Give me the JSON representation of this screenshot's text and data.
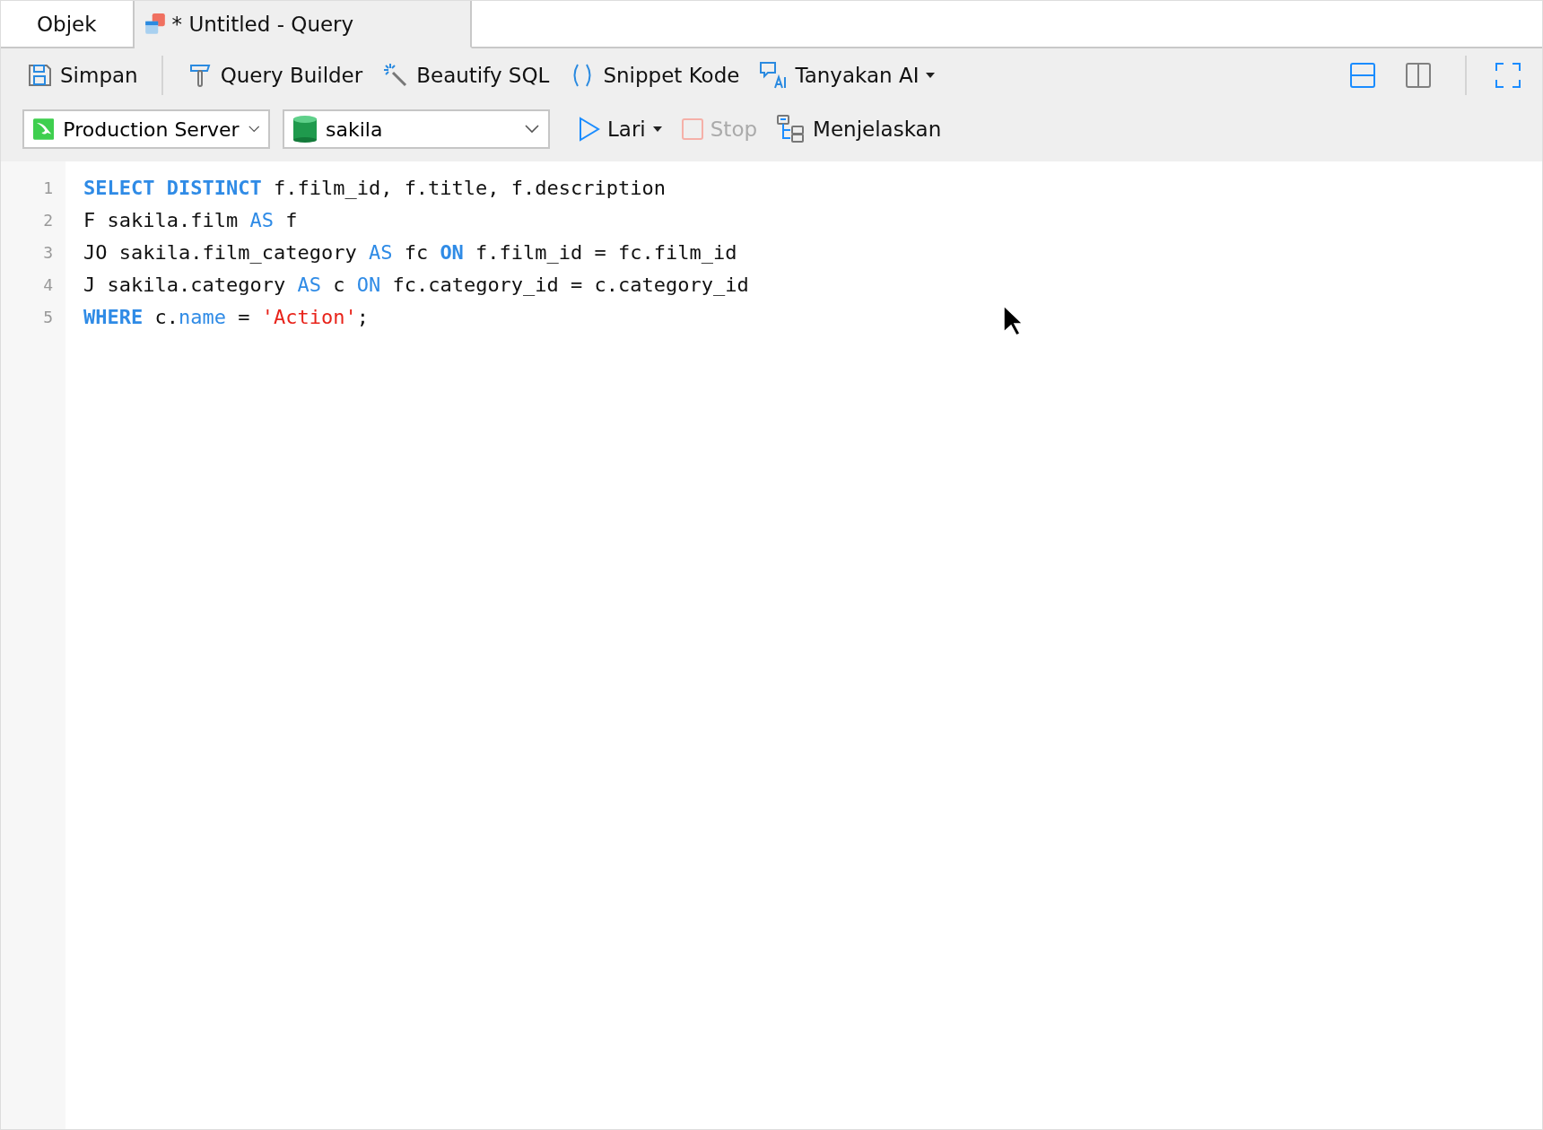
{
  "tabs": [
    {
      "label": "Objek",
      "selected": false,
      "kind": "plain"
    },
    {
      "label": "* Untitled - Query",
      "selected": true,
      "kind": "query"
    }
  ],
  "toolbar": {
    "buttons": [
      {
        "label": "Simpan",
        "kind": "save"
      },
      {
        "label": "Query Builder",
        "kind": "builder"
      },
      {
        "label": "Beautify SQL",
        "kind": "beautify"
      },
      {
        "label": "Snippet Kode",
        "kind": "snippet"
      },
      {
        "label": "Tanyakan AI",
        "kind": "ai"
      }
    ],
    "layouts": [
      {
        "kind": "horizontal",
        "selected": true
      },
      {
        "kind": "vertical",
        "selected": false
      }
    ]
  },
  "connection": {
    "value": "Production Server"
  },
  "database": {
    "value": "sakila"
  },
  "actions": [
    {
      "label": "Lari",
      "kind": "run",
      "disabled": false
    },
    {
      "label": "Stop",
      "kind": "stop",
      "disabled": true
    },
    {
      "label": "Menjelaskan",
      "kind": "explain",
      "disabled": false
    }
  ],
  "editor": {
    "lines": [
      {
        "number": "1",
        "tokens": [
          {
            "text": "SELECT DISTINCT",
            "kind": "keyword_strong"
          },
          {
            "text": " f.film_id, f.title, f.description",
            "kind": "text"
          }
        ]
      },
      {
        "number": "2",
        "tokens": [
          {
            "text": "F sakila.film ",
            "kind": "text"
          },
          {
            "text": "AS",
            "kind": "keyword"
          },
          {
            "text": " f",
            "kind": "text"
          }
        ]
      },
      {
        "number": "3",
        "tokens": [
          {
            "text": "JO sakila.film_category ",
            "kind": "text"
          },
          {
            "text": "AS",
            "kind": "keyword"
          },
          {
            "text": " fc ",
            "kind": "text"
          },
          {
            "text": "ON",
            "kind": "keyword_strong"
          },
          {
            "text": " f.film_id = fc.film_id",
            "kind": "text"
          }
        ]
      },
      {
        "number": "4",
        "tokens": [
          {
            "text": "J sakila.category ",
            "kind": "text"
          },
          {
            "text": "AS",
            "kind": "keyword"
          },
          {
            "text": " c ",
            "kind": "text"
          },
          {
            "text": "ON",
            "kind": "keyword"
          },
          {
            "text": " fc.category_id = c.category_id",
            "kind": "text"
          }
        ]
      },
      {
        "number": "5",
        "tokens": [
          {
            "text": "WHERE",
            "kind": "keyword_strong"
          },
          {
            "text": " c.",
            "kind": "text"
          },
          {
            "text": "name",
            "kind": "keyword"
          },
          {
            "text": " = ",
            "kind": "text"
          },
          {
            "text": "'Action'",
            "kind": "string"
          },
          {
            "text": ";",
            "kind": "text"
          }
        ]
      }
    ]
  }
}
